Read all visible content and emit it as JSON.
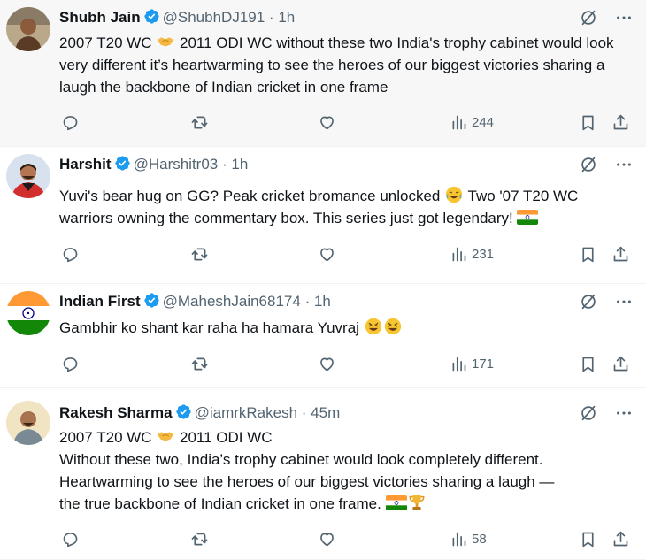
{
  "tweets": [
    {
      "name": "Shubh Jain",
      "handle": "@ShubhDJ191",
      "sep": "·",
      "time": "1h",
      "text_a": "2007 T20 WC ",
      "text_b": " 2011 ODI WC without these two India's trophy cabinet would look very different it’s heartwarming to see the heroes of our biggest victories sharing a laugh the backbone of Indian cricket in one frame",
      "views": "244"
    },
    {
      "name": "Harshit",
      "handle": "@Harshitr03",
      "sep": "·",
      "time": "1h",
      "text_a": "Yuvi's bear hug on GG? Peak cricket bromance unlocked ",
      "text_b": " Two '07 T20 WC warriors owning the commentary box. This series just got legendary! ",
      "views": "231"
    },
    {
      "name": "Indian First",
      "handle": "@MaheshJain68174",
      "sep": "·",
      "time": "1h",
      "text_a": "Gambhir ko shant kar raha ha hamara Yuvraj ",
      "views": "171"
    },
    {
      "name": "Rakesh Sharma",
      "handle": "@iamrkRakesh",
      "sep": "·",
      "time": "45m",
      "line1_a": "2007 T20 WC ",
      "line1_b": " 2011 ODI WC",
      "line2": "Without these two, India’s trophy cabinet would look completely different.",
      "line3": "Heartwarming to see the heroes of our biggest victories sharing a laugh —",
      "line4": "the true backbone of Indian cricket in one frame. ",
      "views": "58"
    }
  ],
  "icons": {
    "verified": "verified-badge-icon",
    "grok": "grok-icon",
    "more": "more-icon",
    "reply": "reply-icon",
    "retweet": "retweet-icon",
    "like": "like-icon",
    "views": "views-icon",
    "bookmark": "bookmark-icon",
    "share": "share-icon"
  },
  "colors": {
    "text": "#0f1419",
    "secondary": "#536471",
    "verified": "#1d9bf0",
    "divider": "#eff3f4",
    "highlight_bg": "#f7f7f7"
  }
}
